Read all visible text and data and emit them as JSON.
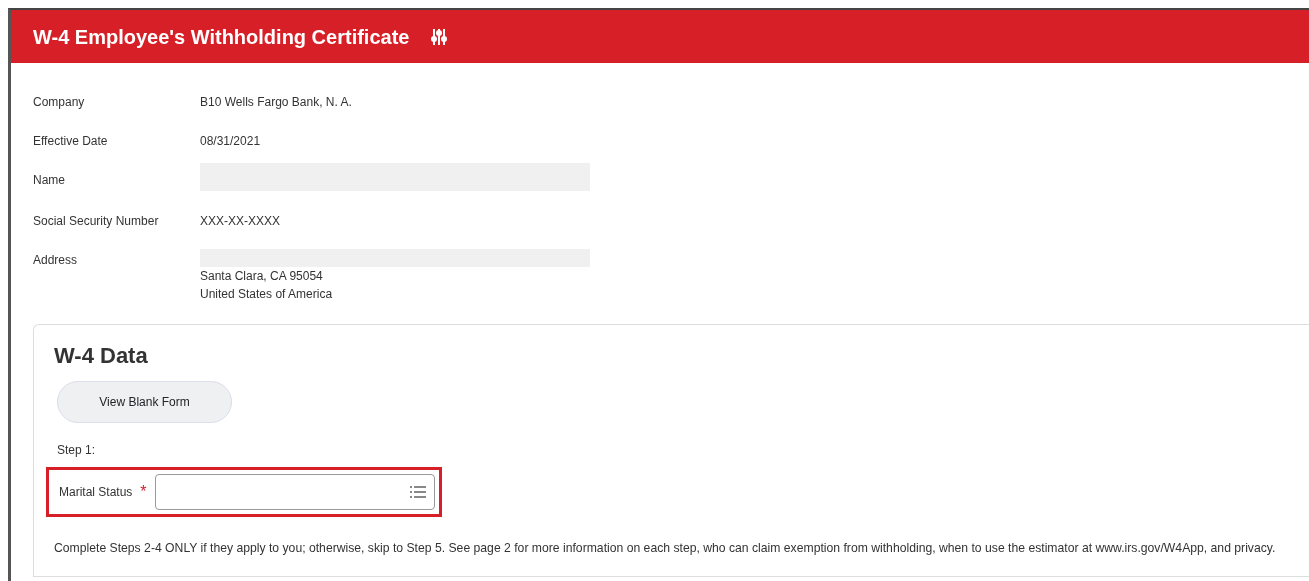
{
  "header": {
    "title": "W-4 Employee's Withholding Certificate"
  },
  "fields": [
    {
      "label": "Company",
      "lines": [
        {
          "text": "B10 Wells Fargo Bank, N. A.",
          "redacted": false
        }
      ]
    },
    {
      "label": "Effective Date",
      "lines": [
        {
          "text": "08/31/2021",
          "redacted": false
        }
      ]
    },
    {
      "label": "Name",
      "lines": [
        {
          "redacted": true
        }
      ]
    },
    {
      "label": "Social Security Number",
      "lines": [
        {
          "text": "XXX-XX-XXXX",
          "redacted": false
        }
      ]
    },
    {
      "label": "Address",
      "lines": [
        {
          "redacted": true
        },
        {
          "text": "Santa Clara, CA 95054",
          "redacted": false
        },
        {
          "text": "United States of America",
          "redacted": false
        }
      ]
    }
  ],
  "w4_data": {
    "title": "W-4 Data",
    "button": "View Blank Form",
    "step": "Step 1:",
    "marital_status": {
      "label": "Marital Status",
      "required_mark": "*",
      "highlighted": true
    },
    "note": "Complete Steps 2-4 ONLY if they apply to you; otherwise, skip to Step 5. See page 2 for more information on each step, who can claim exemption from withholding, when to use the estimator at www.irs.gov/W4App, and privacy."
  }
}
